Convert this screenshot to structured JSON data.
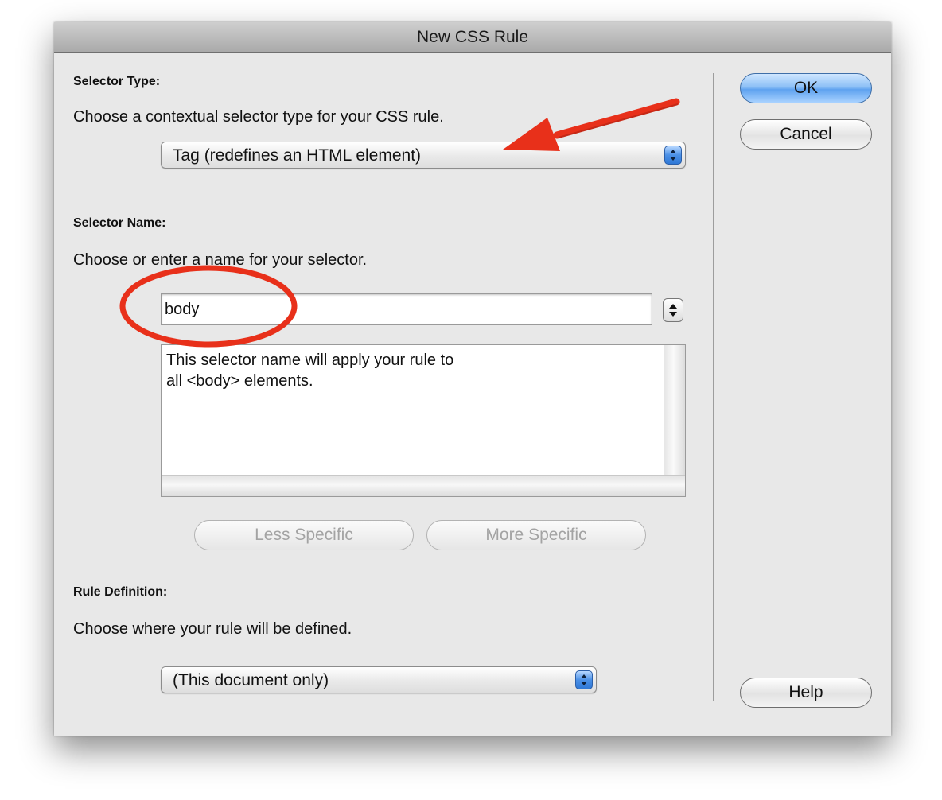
{
  "dialog": {
    "title": "New CSS Rule"
  },
  "selector_type": {
    "heading": "Selector Type:",
    "instruction": "Choose a contextual selector type for your CSS rule.",
    "selected": "Tag (redefines an HTML element)"
  },
  "selector_name": {
    "heading": "Selector Name:",
    "instruction": "Choose or enter a name for your selector.",
    "value": "body",
    "description": "This selector name will apply your rule to\nall <body> elements.",
    "less_specific_label": "Less Specific",
    "more_specific_label": "More Specific"
  },
  "rule_definition": {
    "heading": "Rule Definition:",
    "instruction": "Choose where your rule will be defined.",
    "selected": "(This document only)"
  },
  "buttons": {
    "ok": "OK",
    "cancel": "Cancel",
    "help": "Help"
  },
  "colors": {
    "annotation_red": "#e8301a",
    "default_button_blue": "#5ea2ef",
    "dialog_background": "#e8e8e8"
  },
  "annotations": {
    "arrow": "red-arrow-icon",
    "circle": "red-circle-highlight"
  }
}
